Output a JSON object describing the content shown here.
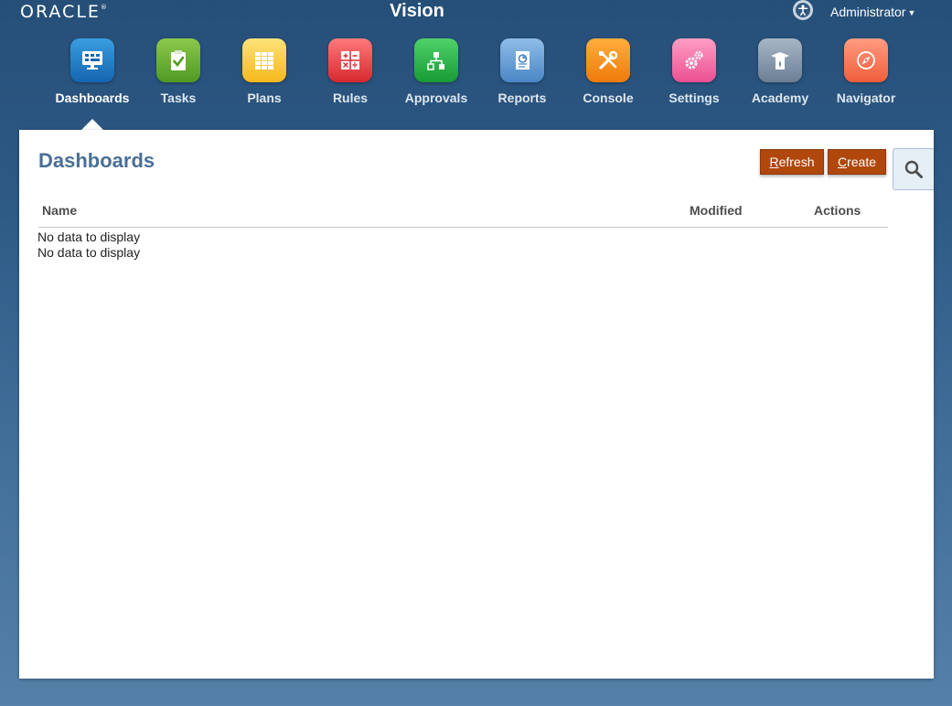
{
  "header": {
    "logo": "ORACLE",
    "logo_mark": "®",
    "app_title": "Vision",
    "accessibility_icon": "accessibility-icon",
    "user_menu": "Administrator"
  },
  "nav": {
    "items": [
      {
        "label": "Dashboards",
        "icon": "monitor-icon",
        "color_top": "#3a9ee0",
        "color_bottom": "#1565b0"
      },
      {
        "label": "Tasks",
        "icon": "clipboard-check-icon",
        "color_top": "#8cc84b",
        "color_bottom": "#4f9a23"
      },
      {
        "label": "Plans",
        "icon": "grid-icon",
        "color_top": "#ffe27a",
        "color_bottom": "#f5b81c"
      },
      {
        "label": "Rules",
        "icon": "calculator-icon",
        "color_top": "#ff7a7a",
        "color_bottom": "#d6282e"
      },
      {
        "label": "Approvals",
        "icon": "hierarchy-icon",
        "color_top": "#4fd26a",
        "color_bottom": "#169b35"
      },
      {
        "label": "Reports",
        "icon": "report-icon",
        "color_top": "#8fbde8",
        "color_bottom": "#4a86c6"
      },
      {
        "label": "Console",
        "icon": "tools-icon",
        "color_top": "#ffae3d",
        "color_bottom": "#ee7a0a"
      },
      {
        "label": "Settings",
        "icon": "gears-icon",
        "color_top": "#ff9ec4",
        "color_bottom": "#ec4f92"
      },
      {
        "label": "Academy",
        "icon": "graduate-icon",
        "color_top": "#a7b6c6",
        "color_bottom": "#6b7f95"
      },
      {
        "label": "Navigator",
        "icon": "compass-icon",
        "color_top": "#ff9c80",
        "color_bottom": "#f05d3a"
      }
    ]
  },
  "panel": {
    "title": "Dashboards",
    "refresh_label": "Refresh",
    "refresh_key": "R",
    "create_label": "Create",
    "create_key": "C",
    "search_icon": "search-icon",
    "columns": [
      "Name",
      "Modified",
      "Actions"
    ],
    "empty_messages": [
      "No data to display",
      "No data to display"
    ]
  },
  "colors": {
    "accent_button": "#b0470c",
    "title_text": "#4a6f95"
  }
}
